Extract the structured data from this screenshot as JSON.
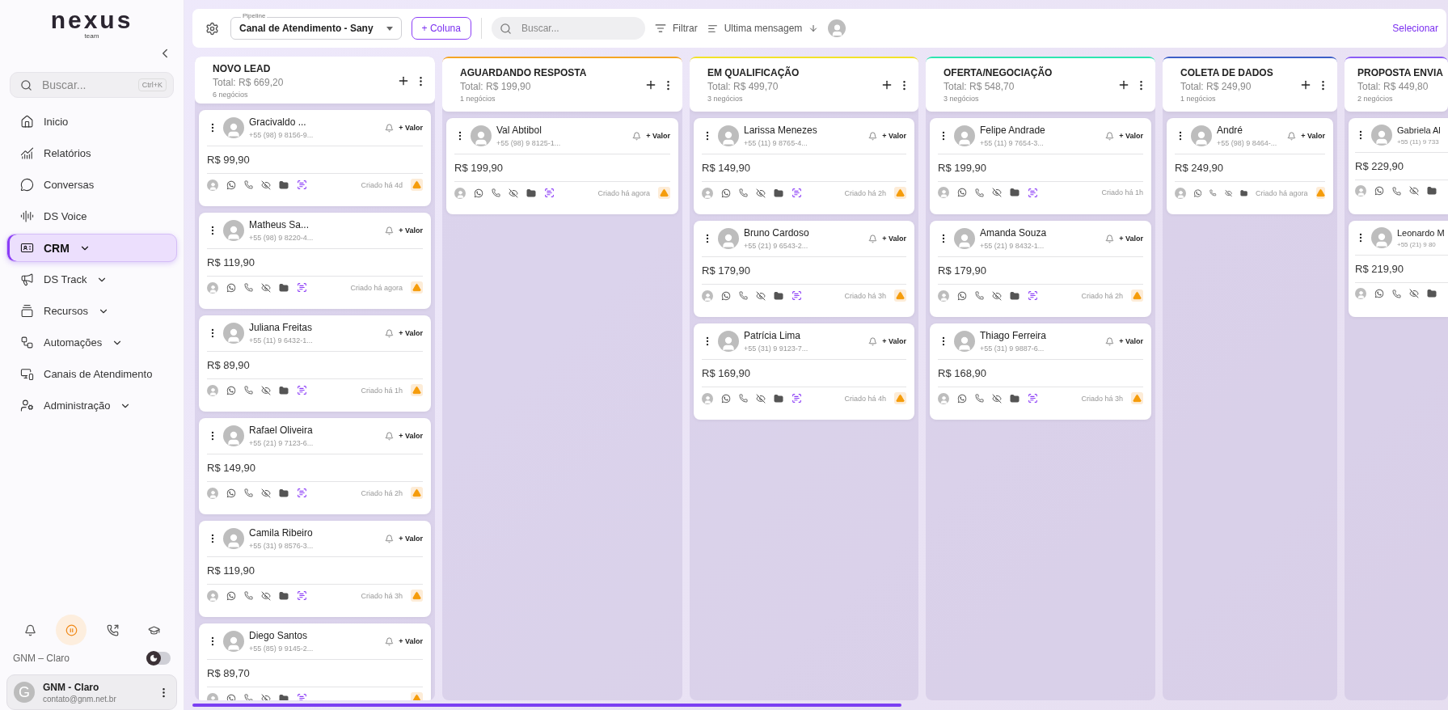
{
  "sidebar": {
    "logo": "nexus",
    "logo_sub": "team",
    "search": {
      "placeholder": "Buscar...",
      "shortcut": "Ctrl+K"
    },
    "items": [
      {
        "kind": "home",
        "label": "Inicio",
        "selected": false,
        "has_submenu": false
      },
      {
        "kind": "reports",
        "label": "Relatórios",
        "selected": false,
        "has_submenu": false
      },
      {
        "kind": "chat",
        "label": "Conversas",
        "selected": false,
        "has_submenu": false
      },
      {
        "kind": "voice",
        "label": "DS Voice",
        "selected": false,
        "has_submenu": false
      },
      {
        "kind": "crm",
        "label": "CRM",
        "selected": true,
        "has_submenu": true
      },
      {
        "kind": "track",
        "label": "DS Track",
        "selected": false,
        "has_submenu": true
      },
      {
        "kind": "resources",
        "label": "Recursos",
        "selected": false,
        "has_submenu": true
      },
      {
        "kind": "automation",
        "label": "Automações",
        "selected": false,
        "has_submenu": true
      },
      {
        "kind": "channels",
        "label": "Canais de Atendimento",
        "selected": false,
        "has_submenu": false
      },
      {
        "kind": "admin",
        "label": "Administração",
        "selected": false,
        "has_submenu": true
      }
    ],
    "workspace_label": "GNM – Claro",
    "dark_mode": {
      "on": false
    },
    "user": {
      "initial": "G",
      "name": "GNM - Claro",
      "email": "contato@gnm.net.br"
    }
  },
  "toolbar": {
    "pipeline": {
      "label": "Pipeline",
      "value": "Canal de Atendimento - Sany"
    },
    "add_column": "+ Coluna",
    "search": {
      "placeholder": "Buscar..."
    },
    "filter": "Filtrar",
    "sort": "Ultima mensagem",
    "select": "Selecionar"
  },
  "columns": [
    {
      "title": "NOVO LEAD",
      "total": "Total: R$ 669,20",
      "count": "6 negócios",
      "cards": [
        {
          "name": "Gracivaldo ...",
          "phone": "+55 (98) 9 8156-9...",
          "valor": "+ Valor",
          "value": "R$ 99,90",
          "created": "Criado há 4d",
          "warning": true,
          "ai": true
        },
        {
          "name": "Matheus Sa...",
          "phone": "+55 (98) 9 8220-4...",
          "valor": "+ Valor",
          "value": "R$ 119,90",
          "created": "Criado há agora",
          "warning": true,
          "ai": true
        },
        {
          "name": "Juliana Freitas",
          "phone": "+55 (11) 9 6432-1...",
          "valor": "+ Valor",
          "value": "R$ 89,90",
          "created": "Criado há 1h",
          "warning": true,
          "ai": true
        },
        {
          "name": "Rafael Oliveira",
          "phone": "+55 (21) 9 7123-6...",
          "valor": "+ Valor",
          "value": "R$ 149,90",
          "created": "Criado há 2h",
          "warning": true,
          "ai": true
        },
        {
          "name": "Camila Ribeiro",
          "phone": "+55 (31) 9 8576-3...",
          "valor": "+ Valor",
          "value": "R$ 119,90",
          "created": "Criado há 3h",
          "warning": true,
          "ai": true
        },
        {
          "name": "Diego Santos",
          "phone": "+55 (85) 9 9145-2...",
          "valor": "+ Valor",
          "value": "R$ 89,70",
          "warning": true,
          "ai": true
        }
      ]
    },
    {
      "title": "AGUARDANDO RESPOSTA",
      "total": "Total: R$ 199,90",
      "count": "1 negócios",
      "color": "#f5a524",
      "cards": [
        {
          "name": "Val Abtibol",
          "phone": "+55 (98) 9 8125-1...",
          "valor": "+ Valor",
          "value": "R$ 199,90",
          "created": "Criado há agora",
          "warning": true,
          "ai": true
        }
      ]
    },
    {
      "title": "EM QUALIFICAÇÃO",
      "total": "Total: R$ 499,70",
      "count": "3 negócios",
      "color": "#f2e22a",
      "cards": [
        {
          "name": "Larissa Menezes",
          "phone": "+55 (11) 9 8765-4...",
          "valor": "+ Valor",
          "value": "R$ 149,90",
          "created": "Criado há 2h",
          "warning": true,
          "ai": true
        },
        {
          "name": "Bruno Cardoso",
          "phone": "+55 (21) 9 6543-2...",
          "valor": "+ Valor",
          "value": "R$ 179,90",
          "created": "Criado há 3h",
          "warning": true,
          "ai": true
        },
        {
          "name": "Patrícia Lima",
          "phone": "+55 (31) 9 9123-7...",
          "valor": "+ Valor",
          "value": "R$ 169,90",
          "created": "Criado há 4h",
          "warning": true,
          "ai": true
        }
      ]
    },
    {
      "title": "OFERTA/NEGOCIAÇÃO",
      "total": "Total: R$ 548,70",
      "count": "3 negócios",
      "color": "#2ee6b0",
      "cards": [
        {
          "name": "Felipe Andrade",
          "phone": "+55 (11) 9 7654-3...",
          "valor": "+ Valor",
          "value": "R$ 199,90",
          "created": "Criado há 1h",
          "warning": false,
          "ai": true
        },
        {
          "name": "Amanda Souza",
          "phone": "+55 (21) 9 8432-1...",
          "valor": "+ Valor",
          "value": "R$ 179,90",
          "created": "Criado há 2h",
          "warning": true,
          "ai": true
        },
        {
          "name": "Thiago Ferreira",
          "phone": "+55 (31) 9 9887-6...",
          "valor": "+ Valor",
          "value": "R$ 168,90",
          "created": "Criado há 3h",
          "warning": true,
          "ai": true
        }
      ]
    },
    {
      "title": "COLETA DE DADOS",
      "total": "Total: R$ 249,90",
      "count": "1 negócios",
      "color": "#3d5fc7",
      "cards": [
        {
          "name": "André",
          "phone": "+55 (98) 9 8464-...",
          "valor": "+ Valor",
          "value": "R$ 249,90",
          "created": "Criado há agora",
          "warning": true,
          "ai": false
        }
      ]
    },
    {
      "title": "PROPOSTA ENVIA",
      "total": "Total: R$ 449,80",
      "count": "2 negócios",
      "color": "#8b5cf6",
      "cut": true,
      "cards": [
        {
          "name": "Gabriela Al",
          "phone": "+55 (11) 9 733",
          "value": "R$ 229,90",
          "warning": false,
          "ai": false
        },
        {
          "name": "Leonardo M",
          "phone": "+55 (21) 9 80",
          "value": "R$ 219,90",
          "warning": false,
          "ai": false
        }
      ]
    }
  ]
}
